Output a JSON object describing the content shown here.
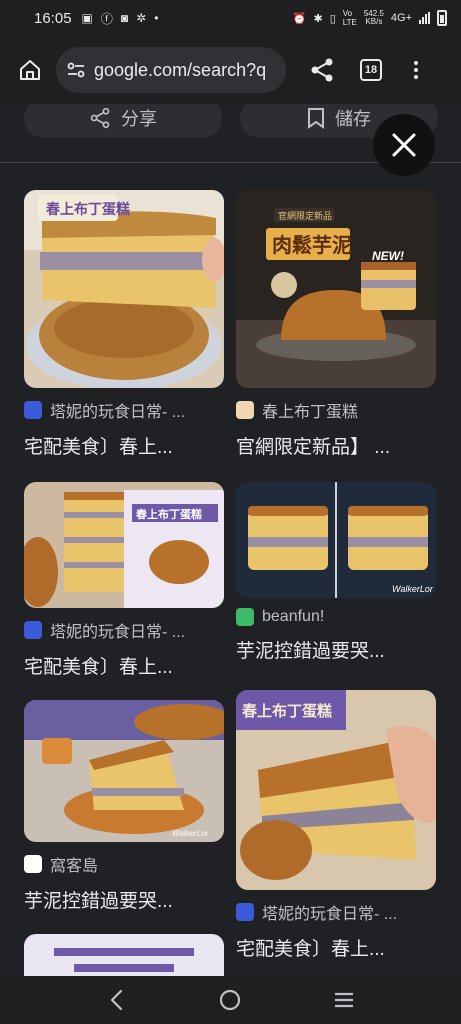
{
  "status_bar": {
    "time": "16:05",
    "network_speed_top": "542.5",
    "network_speed_bottom": "KB/s",
    "network_type": "4G+"
  },
  "toolbar": {
    "url": "google.com/search?q",
    "tab_count": "18"
  },
  "share_row": {
    "share_label": "分享",
    "save_label": "儲存"
  },
  "results": [
    {
      "source": "塔妮的玩食日常- ...",
      "title": "宅配美食〕春上...",
      "favicon_color": "#3b5bdb"
    },
    {
      "source": "春上布丁蛋糕",
      "title": "官網限定新品】 ...",
      "favicon_color": "#f0d7b0"
    },
    {
      "source": "塔妮的玩食日常- ...",
      "title": "宅配美食〕春上...",
      "favicon_color": "#3b5bdb"
    },
    {
      "source": "beanfun!",
      "title": "芋泥控錯過要哭...",
      "favicon_color": "#3dbb6a"
    },
    {
      "source": "窩客島",
      "title": "芋泥控錯過要哭...",
      "favicon_color": "#ffffff"
    },
    {
      "source": "塔妮的玩食日常- ...",
      "title": "宅配美食〕春上...",
      "favicon_color": "#3b5bdb"
    }
  ],
  "image_text": {
    "box_label": "春上布丁蛋糕",
    "poster_top": "官網限定新品",
    "poster_title": "肉鬆芋泥",
    "poster_badge": "NEW!",
    "watermark": "WalkerLor"
  }
}
